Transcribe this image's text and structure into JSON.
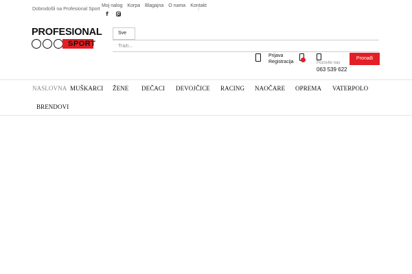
{
  "topbar": {
    "welcome": "Dobrodošli na Profesional Sport",
    "links": [
      "Moj nalog",
      "Korpa",
      "Blagajna",
      "O nama",
      "Kontakt"
    ]
  },
  "logo": {
    "text_top": "PROFESIONAL",
    "text_sport": "SPORT"
  },
  "search": {
    "category": "Sve",
    "placeholder": "Traži...",
    "value": "",
    "button_label": "Pronađi"
  },
  "account": {
    "login": "Prijava",
    "register": "Registracija"
  },
  "contact": {
    "label": "Pozovite nas",
    "phone": "063 539 622"
  },
  "nav": {
    "items": [
      "NASLOVNA",
      "MUŠKARCI",
      "ŽENE",
      "DEČACI",
      "DEVOJČICE",
      "RACING",
      "NAOČARE",
      "OPREMA",
      "VATERPOLO",
      "BRENDOVI"
    ],
    "active_index": 0
  },
  "colors": {
    "accent": "#e31e24",
    "nav_active": "#888888"
  },
  "icons": {
    "social": [
      "facebook-icon",
      "instagram-icon"
    ],
    "account": "user-icon",
    "cart": "cart-icon",
    "phone": "phone-icon"
  }
}
